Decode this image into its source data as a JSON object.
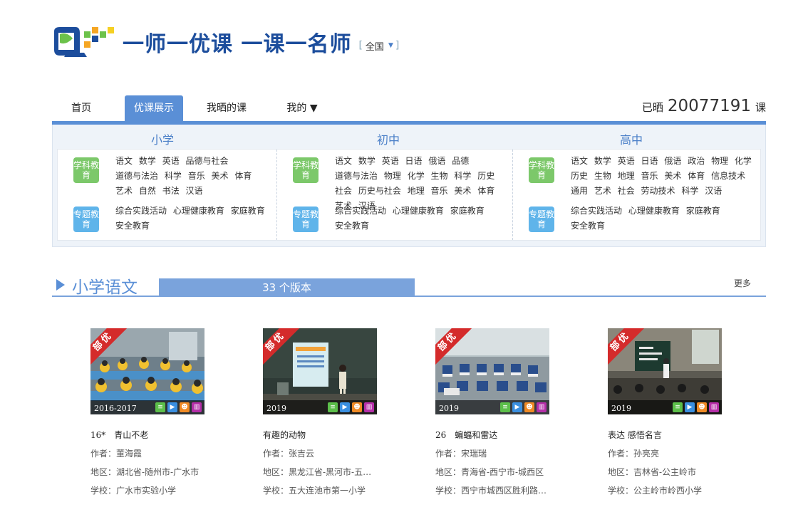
{
  "header": {
    "logo_text": "一师一优课 一课一名师",
    "region_open": "[",
    "region": "全国",
    "region_close": "]"
  },
  "nav": {
    "items": [
      {
        "label": "首页"
      },
      {
        "label": "优课展示"
      },
      {
        "label": "我晒的课"
      },
      {
        "label": "我的 ▼"
      }
    ],
    "count_prefix": "已晒",
    "count_value": "20077191",
    "count_suffix": "课"
  },
  "categories": [
    {
      "title": "小学",
      "subject_badge": "学科教育",
      "subjects": [
        "语文",
        "数学",
        "英语",
        "品德与社会",
        "道德与法治",
        "科学",
        "音乐",
        "美术",
        "体育",
        "艺术",
        "自然",
        "书法",
        "汉语"
      ],
      "topic_badge": "专题教育",
      "topics": [
        "综合实践活动",
        "心理健康教育",
        "家庭教育",
        "安全教育"
      ]
    },
    {
      "title": "初中",
      "subject_badge": "学科教育",
      "subjects": [
        "语文",
        "数学",
        "英语",
        "日语",
        "俄语",
        "品德",
        "道德与法治",
        "物理",
        "化学",
        "生物",
        "科学",
        "历史",
        "社会",
        "历史与社会",
        "地理",
        "音乐",
        "美术",
        "体育",
        "艺术",
        "汉语"
      ],
      "topic_badge": "专题教育",
      "topics": [
        "综合实践活动",
        "心理健康教育",
        "家庭教育",
        "安全教育"
      ]
    },
    {
      "title": "高中",
      "subject_badge": "学科教育",
      "subjects": [
        "语文",
        "数学",
        "英语",
        "日语",
        "俄语",
        "政治",
        "物理",
        "化学",
        "历史",
        "生物",
        "地理",
        "音乐",
        "美术",
        "体育",
        "信息技术",
        "通用",
        "艺术",
        "社会",
        "劳动技术",
        "科学",
        "汉语"
      ],
      "topic_badge": "专题教育",
      "topics": [
        "综合实践活动",
        "心理健康教育",
        "家庭教育",
        "安全教育"
      ]
    }
  ],
  "section": {
    "title": "小学语文",
    "versions": "33 个版本",
    "more": "更多"
  },
  "cards": [
    {
      "ribbon": "部优",
      "year": "2016-2017",
      "title": "16*　青山不老",
      "author": "作者：董海霞",
      "region": "地区：湖北省-随州市-广水市",
      "school": "学校：广水市实验小学"
    },
    {
      "ribbon": "部优",
      "year": "2019",
      "title": "有趣的动物",
      "author": "作者：张吉云",
      "region": "地区：黑龙江省-黑河市-五…",
      "school": "学校：五大连池市第一小学"
    },
    {
      "ribbon": "部优",
      "year": "2019",
      "title": "26　蝙蝠和雷达",
      "author": "作者：宋瑞瑞",
      "region": "地区：青海省-西宁市-城西区",
      "school": "学校：西宁市城西区胜利路…"
    },
    {
      "ribbon": "部优",
      "year": "2019",
      "title": "表达 感悟名言",
      "author": "作者：孙亮亮",
      "region": "地区：吉林省-公主岭市",
      "school": "学校：公主岭市岭西小学"
    }
  ],
  "colors": {
    "accent": "#5a8fd6",
    "ribbon": "#d42b2b",
    "badge_subject": "#7cc86a",
    "badge_topic": "#5fb4ea"
  },
  "icons": {
    "logo": "logo-icon",
    "region_caret": "caret-down-icon",
    "section_arrow": "triangle-right-icon",
    "file_icons": [
      "document-icon",
      "video-icon",
      "skull-icon",
      "stats-icon"
    ]
  }
}
